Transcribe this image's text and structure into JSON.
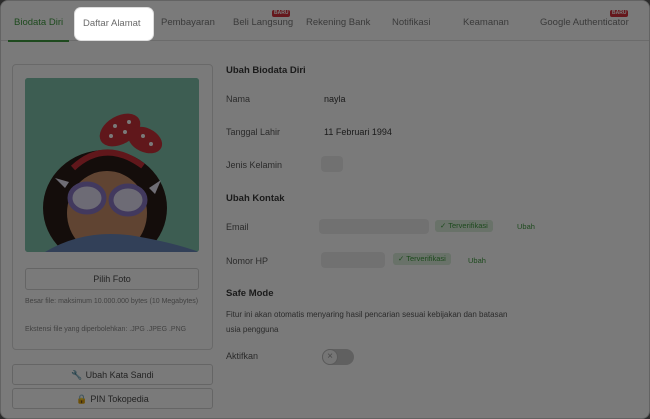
{
  "tabs": [
    {
      "label": "Biodata Diri",
      "active": true
    },
    {
      "label": "Daftar Alamat",
      "highlighted": true
    },
    {
      "label": "Pembayaran"
    },
    {
      "label": "Beli Langsung",
      "badge": "BARU"
    },
    {
      "label": "Rekening Bank"
    },
    {
      "label": "Notifikasi"
    },
    {
      "label": "Keamanan"
    },
    {
      "label": "Google Authenticator",
      "badge": "BARU"
    }
  ],
  "sidebar": {
    "choose_photo": "Pilih Foto",
    "file_size_hint": "Besar file: maksimum 10.000.000 bytes (10 Megabytes)",
    "file_ext_hint": "Ekstensi file yang diperbolehkan: .JPG .JPEG .PNG",
    "change_password": "Ubah Kata Sandi",
    "pin": "PIN Tokopedia"
  },
  "biodata": {
    "title": "Ubah Biodata Diri",
    "name_label": "Nama",
    "name_value": "nayla",
    "dob_label": "Tanggal Lahir",
    "dob_value": "11 Februari 1994",
    "gender_label": "Jenis Kelamin"
  },
  "contact": {
    "title": "Ubah Kontak",
    "email_label": "Email",
    "phone_label": "Nomor HP",
    "verified": "Terverifikasi",
    "change": "Ubah"
  },
  "safe_mode": {
    "title": "Safe Mode",
    "description": "Fitur ini akan otomatis menyaring hasil pencarian sesuai kebijakan dan batasan usia pengguna",
    "enable_label": "Aktifkan",
    "enabled": false
  },
  "colors": {
    "accent": "#3f9b3f",
    "badge": "#d6303b",
    "overlay": "rgba(0,0,0,0.52)"
  }
}
